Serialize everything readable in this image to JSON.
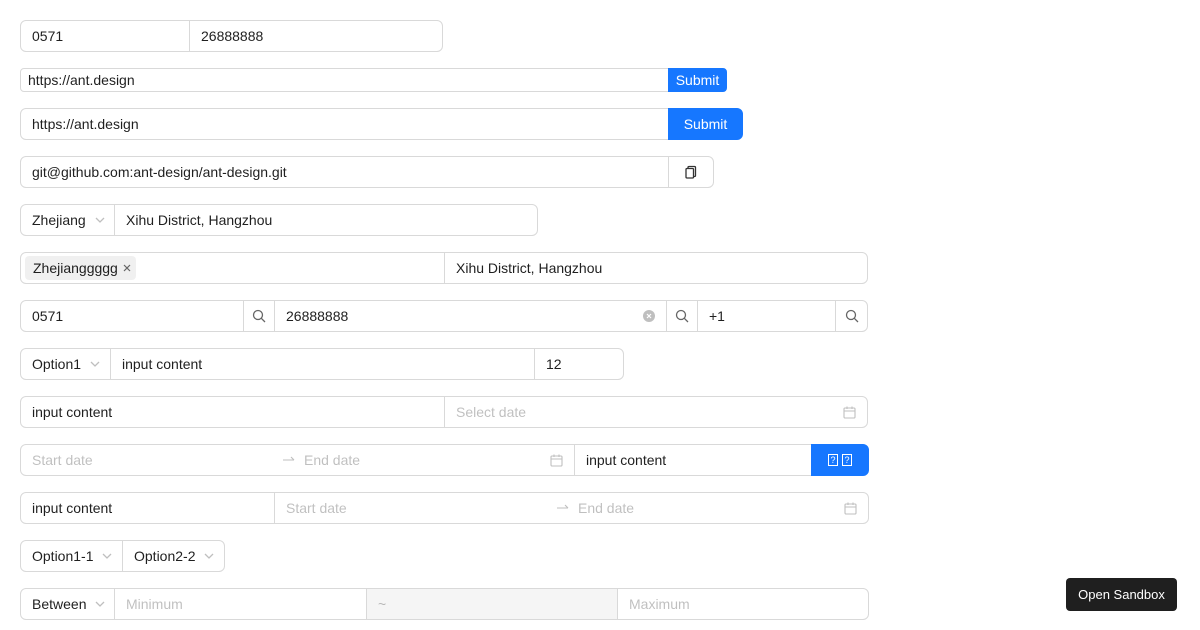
{
  "row1": {
    "area_code": "0571",
    "phone": "26888888"
  },
  "row2": {
    "url": "https://ant.design",
    "submit_label": "Submit"
  },
  "row3": {
    "url": "https://ant.design",
    "submit_label": "Submit"
  },
  "row4": {
    "git_url": "git@github.com:ant-design/ant-design.git",
    "copy_icon": "copy-icon"
  },
  "row5": {
    "province": "Zhejiang",
    "address": "Xihu District, Hangzhou"
  },
  "row6": {
    "tag": "Zhejianggggg",
    "address": "Xihu District, Hangzhou"
  },
  "row7": {
    "area_code": "0571",
    "phone": "26888888",
    "country_code": "+1"
  },
  "row8": {
    "option": "Option1",
    "content": "input content",
    "number": "12"
  },
  "row9": {
    "content": "input content",
    "date_placeholder": "Select date"
  },
  "row10": {
    "start_placeholder": "Start date",
    "end_placeholder": "End date",
    "content": "input content"
  },
  "row11": {
    "content": "input content",
    "start_placeholder": "Start date",
    "end_placeholder": "End date"
  },
  "row12": {
    "option1": "Option1-1",
    "option2": "Option2-2"
  },
  "row13": {
    "mode": "Between",
    "min_placeholder": "Minimum",
    "separator": "~",
    "max_placeholder": "Maximum"
  },
  "sandbox": {
    "label": "Open Sandbox"
  },
  "colors": {
    "primary": "#1677ff",
    "border": "#d9d9d9",
    "dark": "#1f1f1f"
  }
}
